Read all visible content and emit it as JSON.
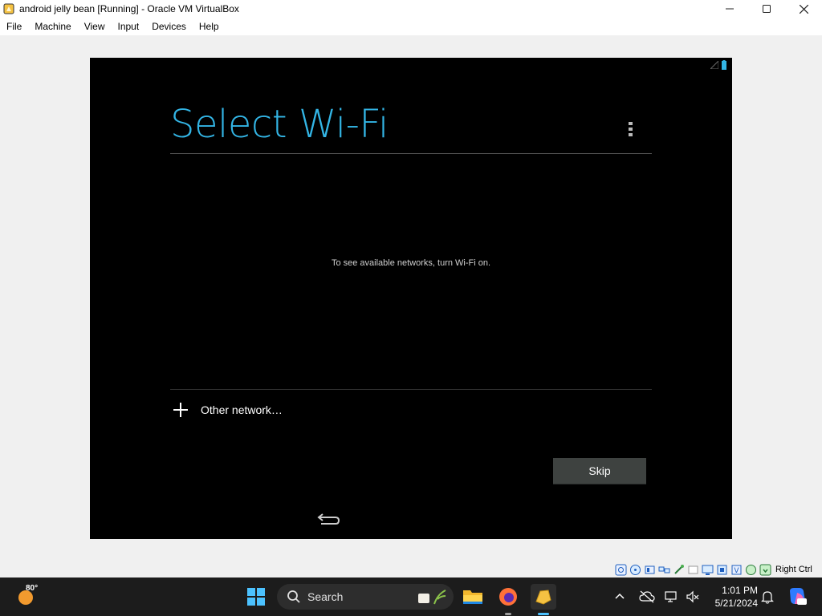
{
  "window": {
    "title": "android jelly bean [Running] - Oracle VM VirtualBox",
    "minimize": "–",
    "maximize": "▢",
    "close": "✕"
  },
  "menu": {
    "items": [
      "File",
      "Machine",
      "View",
      "Input",
      "Devices",
      "Help"
    ]
  },
  "android": {
    "title": "Select Wi-Fi",
    "message": "To see available networks, turn Wi-Fi on.",
    "other_network": "Other network…",
    "skip": "Skip",
    "accent_color": "#33b5e5"
  },
  "vbox_status": {
    "host_key": "Right Ctrl"
  },
  "taskbar": {
    "weather_temp": "80°",
    "search_label": "Search",
    "time": "1:01 PM",
    "date": "5/21/2024"
  }
}
